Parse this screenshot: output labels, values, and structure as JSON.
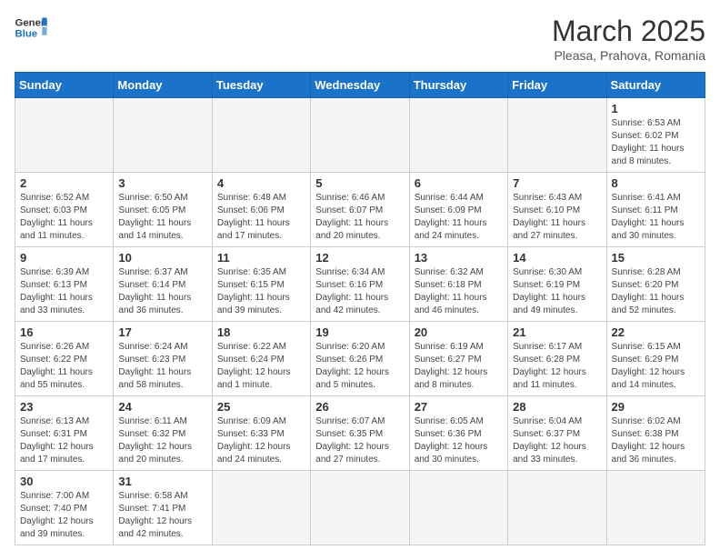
{
  "header": {
    "logo_general": "General",
    "logo_blue": "Blue",
    "month_title": "March 2025",
    "subtitle": "Pleasa, Prahova, Romania"
  },
  "weekdays": [
    "Sunday",
    "Monday",
    "Tuesday",
    "Wednesday",
    "Thursday",
    "Friday",
    "Saturday"
  ],
  "weeks": [
    [
      {
        "day": null,
        "info": ""
      },
      {
        "day": null,
        "info": ""
      },
      {
        "day": null,
        "info": ""
      },
      {
        "day": null,
        "info": ""
      },
      {
        "day": null,
        "info": ""
      },
      {
        "day": null,
        "info": ""
      },
      {
        "day": "1",
        "info": "Sunrise: 6:53 AM\nSunset: 6:02 PM\nDaylight: 11 hours and 8 minutes."
      }
    ],
    [
      {
        "day": "2",
        "info": "Sunrise: 6:52 AM\nSunset: 6:03 PM\nDaylight: 11 hours and 11 minutes."
      },
      {
        "day": "3",
        "info": "Sunrise: 6:50 AM\nSunset: 6:05 PM\nDaylight: 11 hours and 14 minutes."
      },
      {
        "day": "4",
        "info": "Sunrise: 6:48 AM\nSunset: 6:06 PM\nDaylight: 11 hours and 17 minutes."
      },
      {
        "day": "5",
        "info": "Sunrise: 6:46 AM\nSunset: 6:07 PM\nDaylight: 11 hours and 20 minutes."
      },
      {
        "day": "6",
        "info": "Sunrise: 6:44 AM\nSunset: 6:09 PM\nDaylight: 11 hours and 24 minutes."
      },
      {
        "day": "7",
        "info": "Sunrise: 6:43 AM\nSunset: 6:10 PM\nDaylight: 11 hours and 27 minutes."
      },
      {
        "day": "8",
        "info": "Sunrise: 6:41 AM\nSunset: 6:11 PM\nDaylight: 11 hours and 30 minutes."
      }
    ],
    [
      {
        "day": "9",
        "info": "Sunrise: 6:39 AM\nSunset: 6:13 PM\nDaylight: 11 hours and 33 minutes."
      },
      {
        "day": "10",
        "info": "Sunrise: 6:37 AM\nSunset: 6:14 PM\nDaylight: 11 hours and 36 minutes."
      },
      {
        "day": "11",
        "info": "Sunrise: 6:35 AM\nSunset: 6:15 PM\nDaylight: 11 hours and 39 minutes."
      },
      {
        "day": "12",
        "info": "Sunrise: 6:34 AM\nSunset: 6:16 PM\nDaylight: 11 hours and 42 minutes."
      },
      {
        "day": "13",
        "info": "Sunrise: 6:32 AM\nSunset: 6:18 PM\nDaylight: 11 hours and 46 minutes."
      },
      {
        "day": "14",
        "info": "Sunrise: 6:30 AM\nSunset: 6:19 PM\nDaylight: 11 hours and 49 minutes."
      },
      {
        "day": "15",
        "info": "Sunrise: 6:28 AM\nSunset: 6:20 PM\nDaylight: 11 hours and 52 minutes."
      }
    ],
    [
      {
        "day": "16",
        "info": "Sunrise: 6:26 AM\nSunset: 6:22 PM\nDaylight: 11 hours and 55 minutes."
      },
      {
        "day": "17",
        "info": "Sunrise: 6:24 AM\nSunset: 6:23 PM\nDaylight: 11 hours and 58 minutes."
      },
      {
        "day": "18",
        "info": "Sunrise: 6:22 AM\nSunset: 6:24 PM\nDaylight: 12 hours and 1 minute."
      },
      {
        "day": "19",
        "info": "Sunrise: 6:20 AM\nSunset: 6:26 PM\nDaylight: 12 hours and 5 minutes."
      },
      {
        "day": "20",
        "info": "Sunrise: 6:19 AM\nSunset: 6:27 PM\nDaylight: 12 hours and 8 minutes."
      },
      {
        "day": "21",
        "info": "Sunrise: 6:17 AM\nSunset: 6:28 PM\nDaylight: 12 hours and 11 minutes."
      },
      {
        "day": "22",
        "info": "Sunrise: 6:15 AM\nSunset: 6:29 PM\nDaylight: 12 hours and 14 minutes."
      }
    ],
    [
      {
        "day": "23",
        "info": "Sunrise: 6:13 AM\nSunset: 6:31 PM\nDaylight: 12 hours and 17 minutes."
      },
      {
        "day": "24",
        "info": "Sunrise: 6:11 AM\nSunset: 6:32 PM\nDaylight: 12 hours and 20 minutes."
      },
      {
        "day": "25",
        "info": "Sunrise: 6:09 AM\nSunset: 6:33 PM\nDaylight: 12 hours and 24 minutes."
      },
      {
        "day": "26",
        "info": "Sunrise: 6:07 AM\nSunset: 6:35 PM\nDaylight: 12 hours and 27 minutes."
      },
      {
        "day": "27",
        "info": "Sunrise: 6:05 AM\nSunset: 6:36 PM\nDaylight: 12 hours and 30 minutes."
      },
      {
        "day": "28",
        "info": "Sunrise: 6:04 AM\nSunset: 6:37 PM\nDaylight: 12 hours and 33 minutes."
      },
      {
        "day": "29",
        "info": "Sunrise: 6:02 AM\nSunset: 6:38 PM\nDaylight: 12 hours and 36 minutes."
      }
    ],
    [
      {
        "day": "30",
        "info": "Sunrise: 7:00 AM\nSunset: 7:40 PM\nDaylight: 12 hours and 39 minutes."
      },
      {
        "day": "31",
        "info": "Sunrise: 6:58 AM\nSunset: 7:41 PM\nDaylight: 12 hours and 42 minutes."
      },
      {
        "day": null,
        "info": ""
      },
      {
        "day": null,
        "info": ""
      },
      {
        "day": null,
        "info": ""
      },
      {
        "day": null,
        "info": ""
      },
      {
        "day": null,
        "info": ""
      }
    ]
  ]
}
